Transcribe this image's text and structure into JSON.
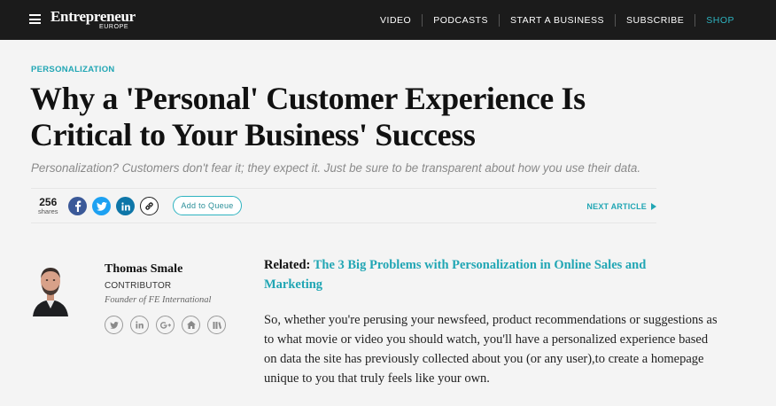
{
  "header": {
    "brand": "Entrepreneur",
    "edition": "EUROPE",
    "nav": [
      "VIDEO",
      "PODCASTS",
      "START A BUSINESS",
      "SUBSCRIBE",
      "SHOP"
    ]
  },
  "article": {
    "kicker": "PERSONALIZATION",
    "title": "Why a 'Personal' Customer Experience Is Critical to Your Business' Success",
    "subtitle": "Personalization? Customers don't fear it; they expect it. Just be sure to be transparent about how you use their data.",
    "share_count": "256",
    "share_label": "shares",
    "queue_label": "Add to Queue",
    "next_label": "NEXT ARTICLE",
    "related_prefix": "Related:",
    "related_link": "The 3 Big Problems with Personalization in Online Sales and Marketing",
    "paragraph": "So, whether you're perusing your newsfeed, product recommendations or suggestions as to what movie or video you should watch, you'll have a personalized experience based on data the site has previously collected about you (or any user),to create a homepage unique to you that truly feels like your own."
  },
  "author": {
    "name": "Thomas Smale",
    "role": "CONTRIBUTOR",
    "bio": "Founder of FE International",
    "social_icons": [
      "twitter-icon",
      "linkedin-icon",
      "google-plus-icon",
      "home-icon",
      "library-icon"
    ]
  },
  "colors": {
    "accent": "#21a6b4",
    "navbar": "#1b1b1b",
    "facebook": "#3b5998",
    "twitter": "#1da1f2",
    "linkedin": "#0e76a8"
  },
  "icons": [
    "menu-icon",
    "facebook-icon",
    "twitter-icon",
    "linkedin-icon",
    "link-icon",
    "play-arrow-icon"
  ]
}
